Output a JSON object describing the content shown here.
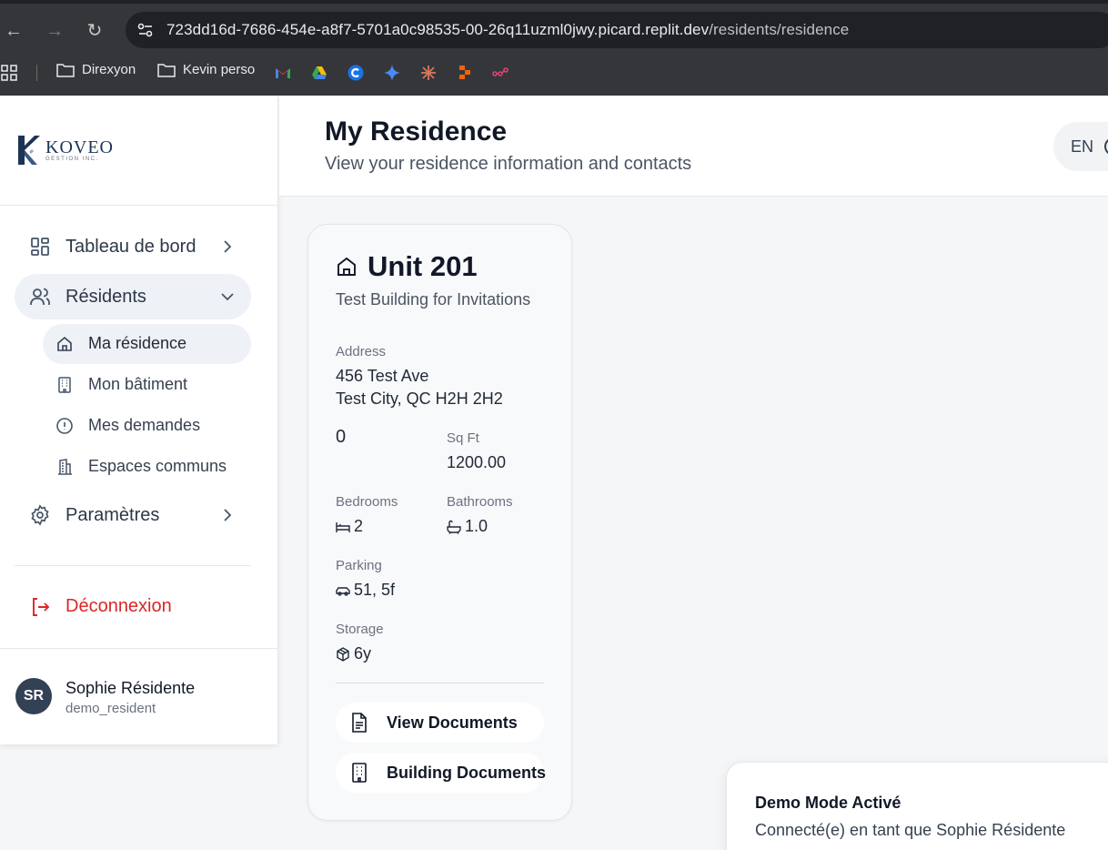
{
  "browser": {
    "url_host": "723dd16d-7686-454e-a8f7-5701a0c98535-00-26q11uzml0jwy.picard.replit.dev",
    "url_path": "/residents/residence",
    "bookmarks": [
      "Direxyon",
      "Kevin perso"
    ]
  },
  "brand": {
    "name": "KOVEO",
    "subtitle": "GESTION INC."
  },
  "sidebar": {
    "items": [
      {
        "label": "Tableau de bord",
        "icon": "dashboard-icon"
      },
      {
        "label": "Résidents",
        "icon": "users-icon"
      },
      {
        "label": "Paramètres",
        "icon": "gear-icon"
      }
    ],
    "sub_items": [
      {
        "label": "Ma résidence",
        "icon": "home-icon"
      },
      {
        "label": "Mon bâtiment",
        "icon": "building-icon"
      },
      {
        "label": "Mes demandes",
        "icon": "alert-circle-icon"
      },
      {
        "label": "Espaces communs",
        "icon": "building-2-icon"
      }
    ],
    "logout_label": "Déconnexion"
  },
  "user": {
    "initials": "SR",
    "name": "Sophie Résidente",
    "handle": "demo_resident"
  },
  "header": {
    "title": "My Residence",
    "subtitle": "View your residence information and contacts",
    "language": "EN"
  },
  "unit": {
    "title": "Unit 201",
    "building": "Test Building for Invitations",
    "address_label": "Address",
    "address_line1": "456 Test Ave",
    "address_line2": "Test City, QC H2H 2H2",
    "floor_value": "0",
    "sqft_label": "Sq Ft",
    "sqft_value": "1200.00",
    "bedrooms_label": "Bedrooms",
    "bedrooms_value": "2",
    "bathrooms_label": "Bathrooms",
    "bathrooms_value": "1.0",
    "parking_label": "Parking",
    "parking_value": "51, 5f",
    "storage_label": "Storage",
    "storage_value": "6y",
    "view_documents_label": "View Documents",
    "building_documents_label": "Building Documents"
  },
  "toast": {
    "title": "Demo Mode Activé",
    "body": "Connecté(e) en tant que Sophie Résidente"
  },
  "colors": {
    "accent_red": "#dc2626",
    "active_bg": "#eef1f5",
    "brand_navy": "#1c3454"
  }
}
